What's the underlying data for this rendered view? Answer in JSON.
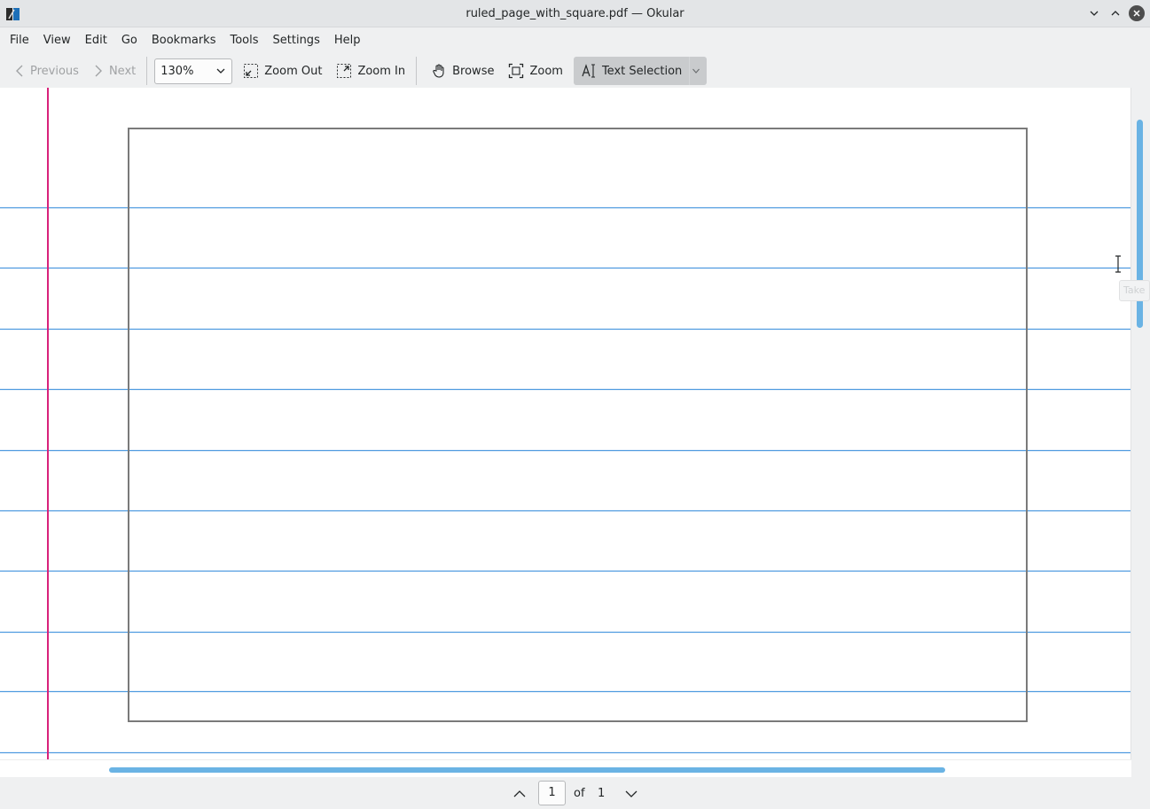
{
  "window": {
    "title": "ruled_page_with_square.pdf — Okular"
  },
  "menubar": {
    "items": [
      "File",
      "View",
      "Edit",
      "Go",
      "Bookmarks",
      "Tools",
      "Settings",
      "Help"
    ]
  },
  "toolbar": {
    "previous_label": "Previous",
    "next_label": "Next",
    "zoom_value": "130%",
    "zoom_out_label": "Zoom Out",
    "zoom_in_label": "Zoom In",
    "browse_label": "Browse",
    "zoom_label": "Zoom",
    "text_selection_label": "Text Selection"
  },
  "tooltip": {
    "fragment": "Take"
  },
  "navigation": {
    "current_page": "1",
    "of_label": "of",
    "total_pages": "1"
  },
  "colors": {
    "ruled_line": "#4f9be0",
    "margin_line": "#d8227a",
    "square_border": "#7a7a7a",
    "scroll_accent": "#6ab3e4"
  }
}
